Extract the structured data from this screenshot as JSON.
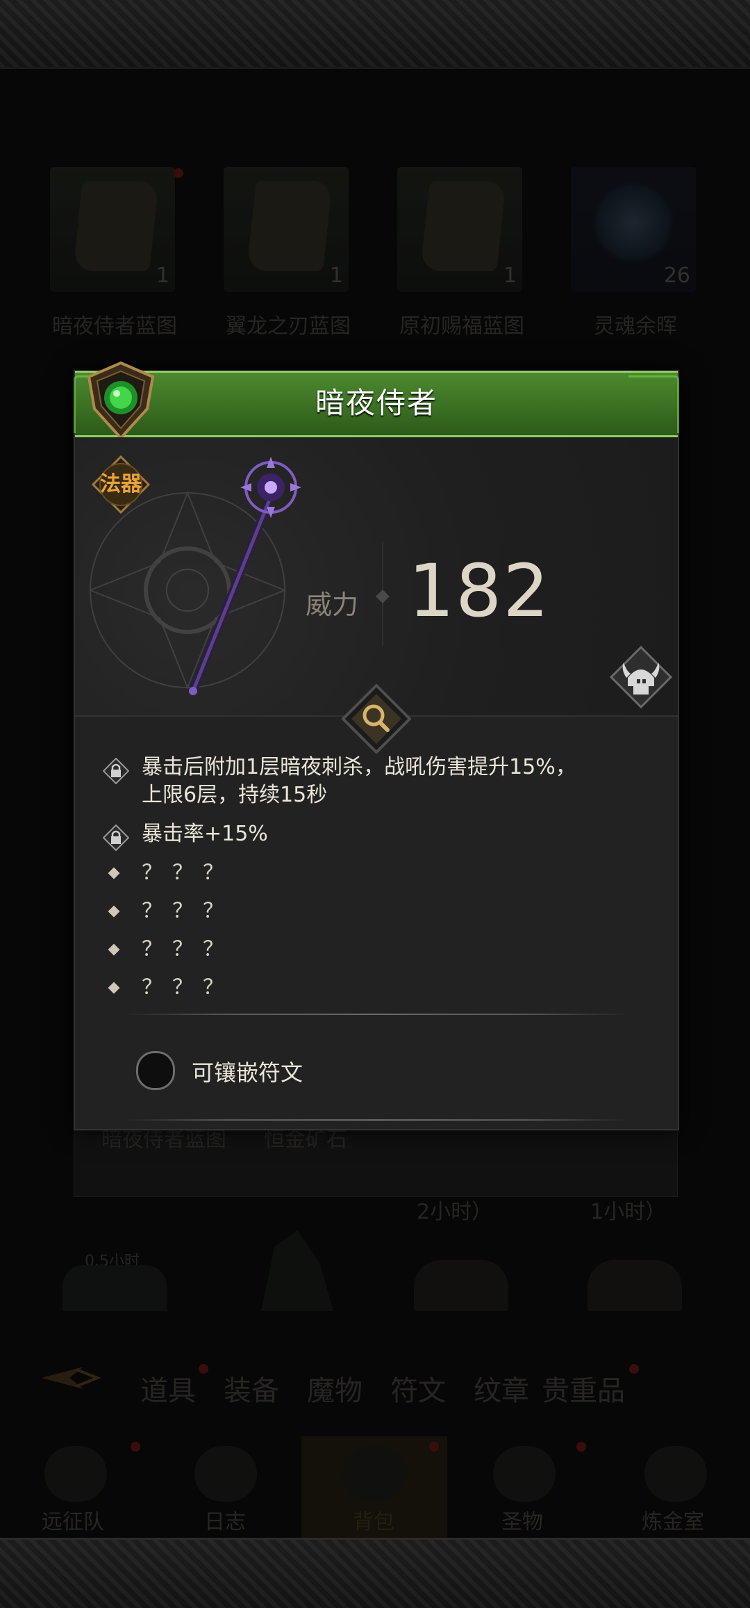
{
  "background": {
    "items_row1": [
      {
        "name": "暗夜侍者蓝图",
        "count": "1"
      },
      {
        "name": "翼龙之刃蓝图",
        "count": "1"
      },
      {
        "name": "原初赐福蓝图",
        "count": "1"
      },
      {
        "name": "灵魂余晖",
        "count": "26"
      }
    ],
    "below_dialog": [
      "暗夜侍者蓝图",
      "恒金矿石"
    ],
    "timers": [
      "2小时）",
      "1小时）",
      "0.5小时"
    ],
    "tabs": [
      "道具",
      "装备",
      "魔物",
      "符文",
      "纹章",
      "贵重品"
    ],
    "nav": [
      "远征队",
      "日志",
      "背包",
      "圣物",
      "炼金室"
    ]
  },
  "dialog": {
    "title": "暗夜侍者",
    "category_badge": "法器",
    "power_label": "威力",
    "power_value": "182",
    "class_icon": "viking-helmet-icon",
    "attributes": [
      {
        "icon": "lock-icon",
        "text": "暴击后附加1层暗夜刺杀，战吼伤害提升15%，\n上限6层，持续15秒"
      },
      {
        "icon": "lock-icon",
        "text": "暴击率+15%"
      },
      {
        "icon": "diamond-bullet",
        "text": "？？？"
      },
      {
        "icon": "diamond-bullet",
        "text": "？？？"
      },
      {
        "icon": "diamond-bullet",
        "text": "？？？"
      },
      {
        "icon": "diamond-bullet",
        "text": "？？？"
      }
    ],
    "rune_label": "可镶嵌符文"
  },
  "colors": {
    "header_green": "#3a7123",
    "badge_orange": "#e9a53a",
    "panel": "#222222"
  }
}
